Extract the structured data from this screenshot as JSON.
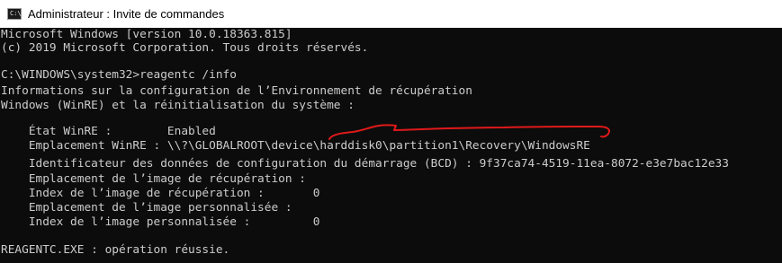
{
  "window": {
    "title": "Administrateur : Invite de commandes",
    "icon": "cmd-icon",
    "icon_glyph": "C:\\_"
  },
  "console": {
    "lines": [
      "Microsoft Windows [version 10.0.18363.815]",
      "(c) 2019 Microsoft Corporation. Tous droits réservés.",
      "",
      "C:\\WINDOWS\\system32>reagentc /info",
      "Informations sur la configuration de l’Environnement de récupération",
      "Windows (WinRE) et la réinitialisation du système :",
      "",
      "    État WinRE :        Enabled",
      "    Emplacement WinRE : \\\\?\\GLOBALROOT\\device\\harddisk0\\partition1\\Recovery\\WindowsRE",
      "    Identificateur des données de configuration du démarrage (BCD) : 9f37ca74-4519-11ea-8072-e3e7bac12e33",
      "    Emplacement de l’image de récupération :",
      "    Index de l’image de récupération :       0",
      "    Emplacement de l’image personnalisée :",
      "    Index de l’image personnalisée :         0",
      "",
      "REAGENTC.EXE : opération réussie."
    ]
  },
  "annotation": {
    "color": "#e0191a"
  }
}
